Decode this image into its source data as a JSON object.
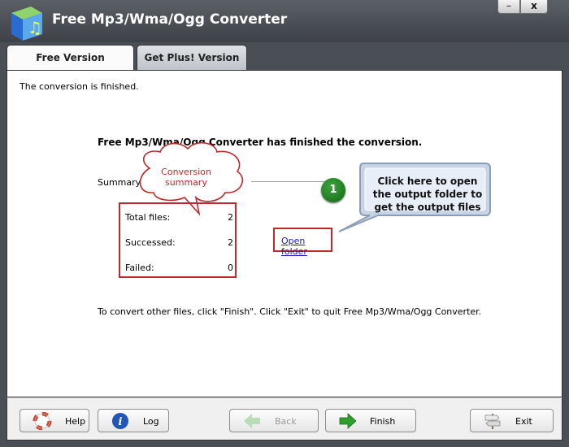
{
  "window": {
    "title": "Free Mp3/Wma/Ogg Converter",
    "minimize_glyph": "–",
    "close_glyph": "x"
  },
  "tabs": [
    {
      "label": "Free Version",
      "active": true
    },
    {
      "label": "Get Plus! Version",
      "active": false
    }
  ],
  "main": {
    "status_text": "The conversion is finished.",
    "headline": "Free Mp3/Wma/Ogg Converter has finished the conversion.",
    "summary_label": "Summary",
    "stats": [
      {
        "label": "Total files:",
        "value": "2"
      },
      {
        "label": "Successed:",
        "value": "2"
      },
      {
        "label": "Failed:",
        "value": "0"
      }
    ],
    "open_folder_link": "Open folder",
    "bottom_note": "To convert other files, click \"Finish\". Click \"Exit\" to quit Free Mp3/Wma/Ogg Converter."
  },
  "annotations": {
    "cloud_line1": "Conversion",
    "cloud_line2": "summary",
    "marker_number": "1",
    "tip_line1": "Click here to open",
    "tip_line2": "the output folder to",
    "tip_line3": "get the output files"
  },
  "buttons": {
    "help": "Help",
    "log": "Log",
    "back": "Back",
    "finish": "Finish",
    "exit": "Exit"
  },
  "icons": {
    "app": "music-note-cube-icon",
    "help": "lifebuoy-icon",
    "log": "info-icon",
    "back": "green-arrow-left-icon",
    "finish": "green-arrow-right-icon",
    "exit": "signpost-icon"
  },
  "colors": {
    "annotation_red": "#c0282a",
    "link_blue": "#1b1bbb",
    "marker_green": "#1f8a22",
    "titlebar": "#4a4e55"
  }
}
